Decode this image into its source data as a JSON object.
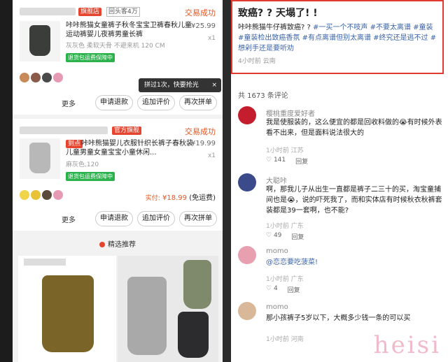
{
  "orders": [
    {
      "shop_tag": "旗舰店",
      "shop_sub": "回头客4万",
      "status": "交易成功",
      "title": "咔咔熊猫女童裤子秋冬宝宝卫裤春秋儿童运动裤婴儿夜裤男童长裤",
      "spec": "灰灰色 柔软天骨 不避来机 120 CM",
      "price": "¥25.99",
      "qty": "x1",
      "guarantee": "退货包运费保障中"
    },
    {
      "shop_tag": "官方旗舰",
      "status": "交易成功",
      "badge": "到点",
      "title": "咔咔熊猫婴儿衣服针织长裤子春秋装儿童男童女童宝宝小童休闲...",
      "spec": "麻灰色,120",
      "price": "¥19.99",
      "qty": "x1",
      "guarantee": "退货包运费保障中",
      "paid_label": "实付:",
      "paid_amount": "¥18.99",
      "paid_note": "(免运费)"
    }
  ],
  "tooltip": {
    "text": "拼过1次，快要抢光",
    "close": "×"
  },
  "buttons": {
    "more": "更多",
    "refund": "申请退款",
    "review": "追加评价",
    "regroup": "再次拼单"
  },
  "recommend": {
    "label": "精选推荐"
  },
  "post": {
    "title": "致癌? ? 天塌了! !",
    "body_plain": "咔咔熊猫牛仔裤致癌? ? ",
    "hashtags": [
      "#一买一个不吱声",
      "#不要太离谱",
      "#童装",
      "#童装检出致癌香氛",
      "#有点离谱但别太离谱",
      "#终究还是逃不过",
      "#想剁手还是要听劝"
    ],
    "meta": "4小时前  云南"
  },
  "comments_count": "共 1673 条评论",
  "comments": [
    {
      "name": "樱桃重度爱好者",
      "text": "我是使服装的，这么便宜的都是回收料做的😭有时候外表看不出来，但是面料说法很大的",
      "time": "1小时前  江苏",
      "likes": "141",
      "replies": "回复"
    },
    {
      "name": "大聪咔",
      "text": "啊，那我儿子从出生一直都是裤子二三十的买，淘宝童捕间也是😭，说的吓死我了，而和实体店有时候秋衣秋裤套装都是39一套啊，也不能?",
      "time": "1小时前  广东",
      "likes": "49",
      "replies": "回复"
    },
    {
      "name": "momo",
      "mention": "@恋恋要吃菠菜!",
      "text": "",
      "time": "1小时前  广东",
      "likes": "4",
      "replies": "回复"
    },
    {
      "name": "momo",
      "text": "那小孩裤子5岁以下，大概多少钱一条的可以买",
      "time": "1小时前  河南",
      "likes": "",
      "replies": ""
    }
  ],
  "watermark": "heisi"
}
